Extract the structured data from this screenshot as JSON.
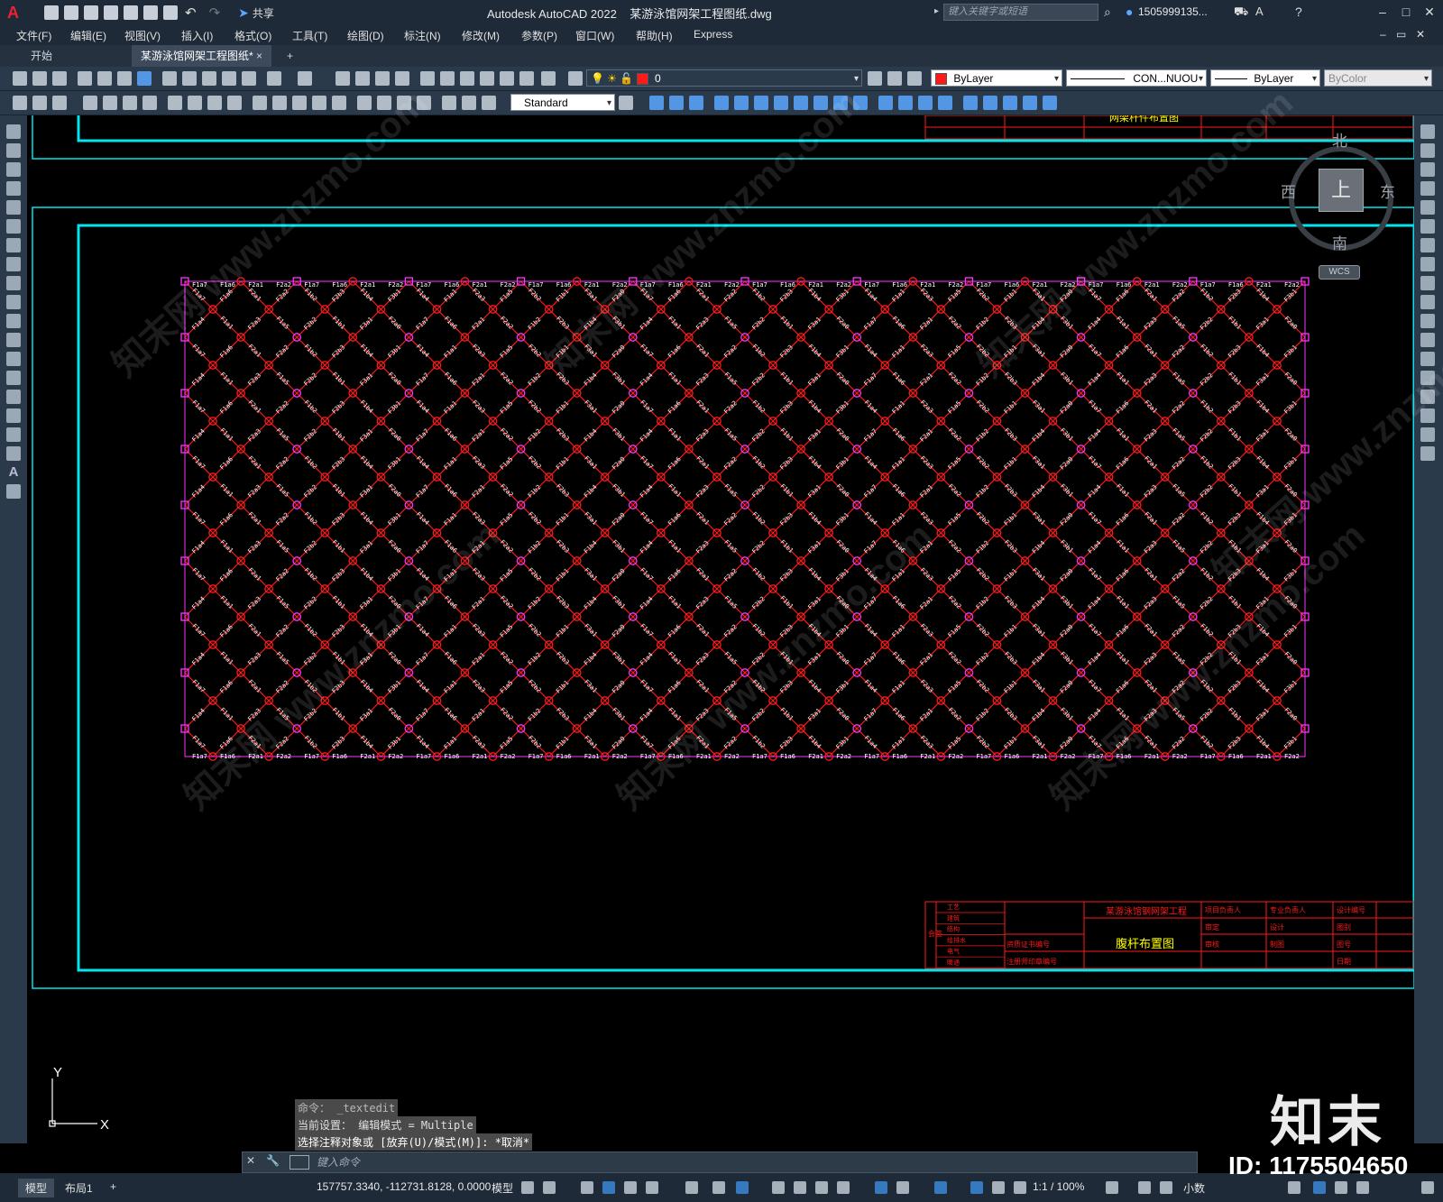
{
  "app": {
    "title": "Autodesk AutoCAD 2022    某游泳馆网架工程图纸.dwg",
    "logo": "A",
    "search_placeholder": "键入关键字或短语",
    "user": "1505999135...",
    "share_label": "共享"
  },
  "menu": [
    "文件(F)",
    "编辑(E)",
    "视图(V)",
    "插入(I)",
    "格式(O)",
    "工具(T)",
    "绘图(D)",
    "标注(N)",
    "修改(M)",
    "参数(P)",
    "窗口(W)",
    "帮助(H)",
    "Express"
  ],
  "tabs": {
    "start": "开始",
    "drawing": "某游泳馆网架工程图纸*",
    "close": "×",
    "new": "+"
  },
  "toolbar": {
    "layer_value": "0",
    "color_value": "ByLayer",
    "linetype_value": "CON...NUOU",
    "lineweight_value": "ByLayer",
    "plotstyle_value": "ByColor",
    "textstyle_value": "Standard"
  },
  "viewcube": {
    "north": "北",
    "south": "南",
    "east": "东",
    "west": "西",
    "top": "上",
    "wcs": "WCS"
  },
  "title_block": {
    "project": "某游泳馆钢网架工程",
    "sheet_title": "腹杆布置图",
    "sheet_title_top": "网架杆件布置图",
    "disciplines": [
      "工艺",
      "建筑",
      "结构",
      "给排水",
      "电气",
      "暖通"
    ],
    "sign_labels": [
      "项目负责人",
      "审定",
      "审核",
      "专业负责人",
      "设计",
      "制图",
      "设计编号",
      "图别",
      "图号",
      "日期"
    ],
    "cert_labels": [
      "资质证书编号",
      "注册师印章编号"
    ],
    "side_label": "会签"
  },
  "grid_labels": [
    "F1a7",
    "F1a6",
    "F2a1",
    "F2a2",
    "F1b2",
    "F2b3",
    "F1b4",
    "F3b1",
    "F1a4",
    "F1a1",
    "F2a3",
    "F1a5",
    "F2b2",
    "F1b1",
    "F3a1",
    "F2a0"
  ],
  "ucs": {
    "y": "Y",
    "x": "X"
  },
  "command": {
    "history": [
      "命令： _textedit",
      "当前设置： 编辑模式 = Multiple",
      "选择注释对象或 [放弃(U)/模式(M)]: *取消*"
    ],
    "placeholder": "键入命令"
  },
  "status": {
    "model_tab": "模型",
    "layout_tab": "布局1",
    "add_tab": "+",
    "coords": "157757.3340, -112731.8128, 0.0000",
    "mode": "模型",
    "scale": "1:1 / 100%",
    "units": "小数"
  },
  "watermark": {
    "brand": "知末",
    "id": "ID: 1175504650",
    "diagonal": "知末网 www.znzmo.com"
  },
  "colors": {
    "frame": "#00e5ee",
    "titleblock": "#ff1a1a",
    "node_red": "#ff1a1a",
    "node_magenta": "#ff33ff",
    "member": "#ff1a1a",
    "label": "#ffffff"
  }
}
